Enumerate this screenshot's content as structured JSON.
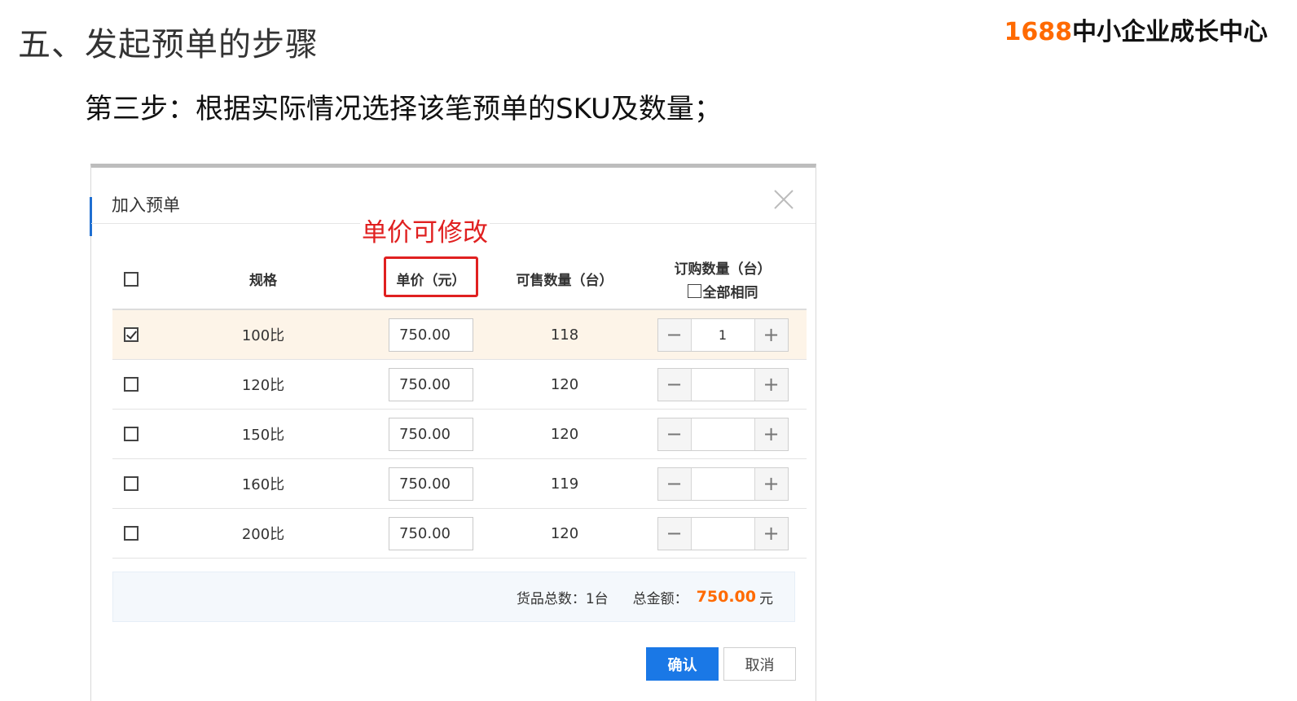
{
  "slide": {
    "title": "五、发起预单的步骤",
    "subtitle": "第三步：根据实际情况选择该笔预单的SKU及数量；",
    "brand_number": "1688",
    "brand_text": "中小企业成长中心"
  },
  "dialog": {
    "title": "加入预单",
    "annotation": "单价可修改",
    "columns": {
      "spec": "规格",
      "unit_price": "单价（元）",
      "available": "可售数量（台）",
      "order_qty": "订购数量（台）",
      "all_same": "全部相同"
    },
    "rows": [
      {
        "checked": true,
        "spec": "100比",
        "price": "750.00",
        "available": "118",
        "qty": "1"
      },
      {
        "checked": false,
        "spec": "120比",
        "price": "750.00",
        "available": "120",
        "qty": ""
      },
      {
        "checked": false,
        "spec": "150比",
        "price": "750.00",
        "available": "120",
        "qty": ""
      },
      {
        "checked": false,
        "spec": "160比",
        "price": "750.00",
        "available": "119",
        "qty": ""
      },
      {
        "checked": false,
        "spec": "200比",
        "price": "750.00",
        "available": "120",
        "qty": ""
      }
    ],
    "summary": {
      "total_count_label": "货品总数：1台",
      "total_amount_label": "总金额：",
      "total_amount": "750.00",
      "currency_unit": "元"
    },
    "buttons": {
      "confirm": "确认",
      "cancel": "取消"
    },
    "stepper_symbols": {
      "minus": "−",
      "plus": "+"
    },
    "colors": {
      "accent_blue": "#1a78e6",
      "amount_orange": "#ff6a00",
      "annotation_red": "#e02020",
      "selected_row": "#fdf4e8"
    }
  }
}
